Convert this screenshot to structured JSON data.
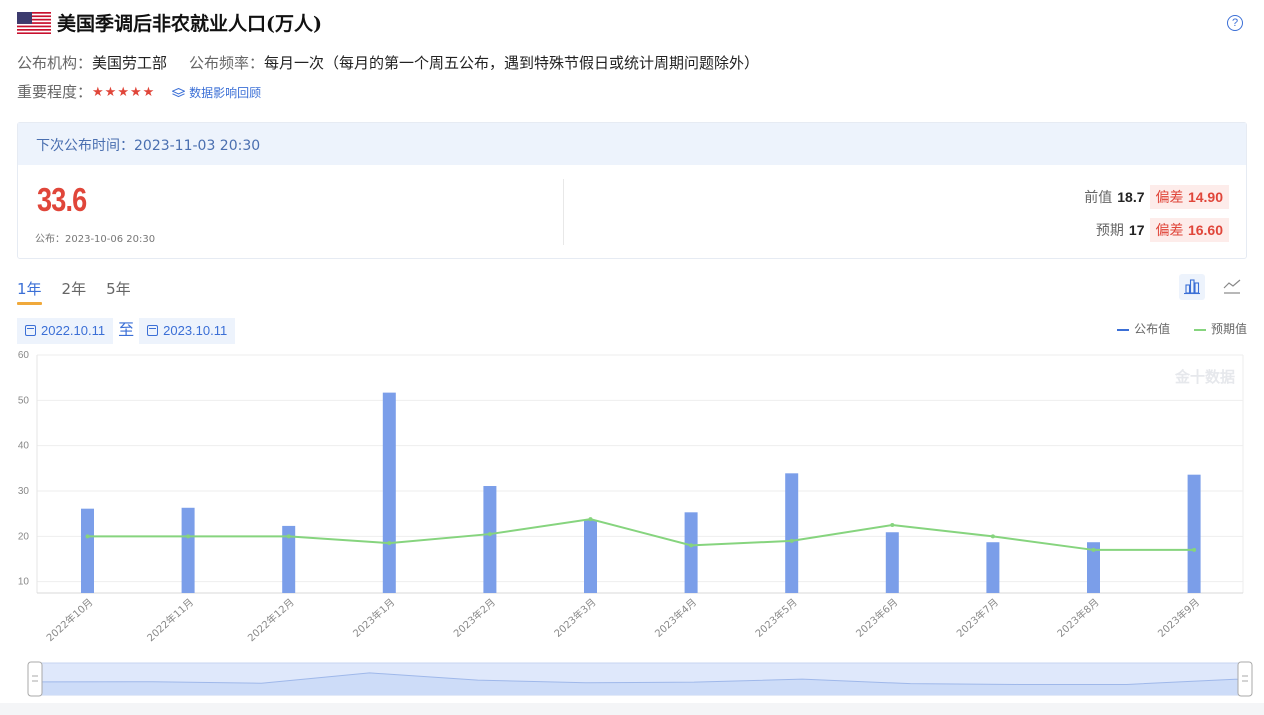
{
  "header": {
    "title": "美国季调后非农就业人口(万人)",
    "help_symbol": "?"
  },
  "meta": {
    "publisher_label": "公布机构：",
    "publisher": "美国劳工部",
    "frequency_label": "公布频率：",
    "frequency": "每月一次（每月的第一个周五公布，遇到特殊节假日或统计周期问题除外）",
    "importance_label": "重要程度：",
    "stars": "★★★★★",
    "response_link": "数据影响回顾"
  },
  "release": {
    "next_label": "下次公布时间：",
    "next_time": "2023-11-03 20:30",
    "actual": "33.6",
    "published_label": "公布：",
    "published_time": "2023-10-06 20:30",
    "previous_label": "前值",
    "previous": "18.7",
    "forecast_label": "预期",
    "forecast": "17",
    "deviation_label": "偏差",
    "deviation_previous": "14.90",
    "deviation_forecast": "16.60"
  },
  "tabs": [
    "1年",
    "2年",
    "5年"
  ],
  "active_tab": 0,
  "date_range": {
    "start": "2022.10.11",
    "to_label": "至",
    "end": "2023.10.11"
  },
  "legend": {
    "actual": "公布值",
    "forecast": "预期值"
  },
  "colors": {
    "accent": "#3b6fd6",
    "bar": "#7b9ee9",
    "forecast_line": "#86d47e",
    "highlight": "#e0463a",
    "tab_underline": "#f0a93b"
  },
  "chart_data": {
    "type": "bar",
    "categories": [
      "2022年10月",
      "2022年11月",
      "2022年12月",
      "2023年1月",
      "2023年2月",
      "2023年3月",
      "2023年4月",
      "2023年5月",
      "2023年6月",
      "2023年7月",
      "2023年8月",
      "2023年9月"
    ],
    "series": [
      {
        "name": "公布值",
        "type": "bar",
        "values": [
          26.1,
          26.3,
          22.3,
          51.7,
          31.1,
          23.6,
          25.3,
          33.9,
          20.9,
          18.7,
          18.7,
          33.6
        ]
      },
      {
        "name": "预期值",
        "type": "line",
        "values": [
          20.0,
          20.0,
          20.0,
          18.5,
          20.5,
          23.8,
          18.0,
          19.0,
          22.5,
          20.0,
          17.0,
          17.0
        ]
      }
    ],
    "y_ticks": [
      10,
      20,
      30,
      40,
      50,
      60
    ],
    "ylim": [
      7.5,
      60
    ],
    "grid": true,
    "watermark": "金十数据"
  }
}
